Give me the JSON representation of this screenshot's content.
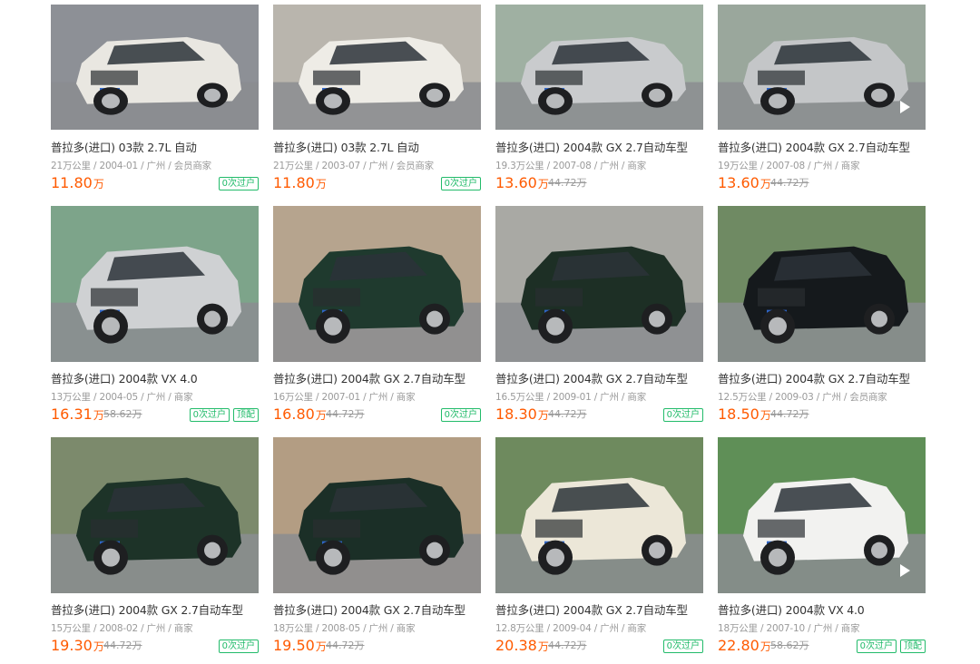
{
  "colors": {
    "price": "#ff5a00",
    "meta": "#9a9a9a",
    "tag": "#22bb6a",
    "title": "#333333"
  },
  "listings": [
    {
      "title": "普拉多(进口) 03款 2.7L 自动",
      "meta": "21万公里 / 2004-01 / 广州 / 会员商家",
      "price": "11.80",
      "unit": "万",
      "original_price": "",
      "tags": [
        "0次过户"
      ],
      "has_video": false,
      "car_color": "#e9e7e1",
      "bg": "#8d9096"
    },
    {
      "title": "普拉多(进口) 03款 2.7L 自动",
      "meta": "21万公里 / 2003-07 / 广州 / 会员商家",
      "price": "11.80",
      "unit": "万",
      "original_price": "",
      "tags": [
        "0次过户"
      ],
      "has_video": false,
      "car_color": "#eeece6",
      "bg": "#b9b5ad"
    },
    {
      "title": "普拉多(进口) 2004款 GX 2.7自动车型",
      "meta": "19.3万公里 / 2007-08 / 广州 / 商家",
      "price": "13.60",
      "unit": "万",
      "original_price": "44.72万",
      "tags": [],
      "has_video": false,
      "car_color": "#c9cbcd",
      "bg": "#9fb0a2"
    },
    {
      "title": "普拉多(进口) 2004款 GX 2.7自动车型",
      "meta": "19万公里 / 2007-08 / 广州 / 商家",
      "price": "13.60",
      "unit": "万",
      "original_price": "44.72万",
      "tags": [],
      "has_video": true,
      "car_color": "#c4c6c8",
      "bg": "#9aa79c"
    },
    {
      "title": "普拉多(进口) 2004款 VX 4.0",
      "meta": "13万公里 / 2004-05 / 广州 / 商家",
      "price": "16.31",
      "unit": "万",
      "original_price": "58.62万",
      "tags": [
        "0次过户",
        "顶配"
      ],
      "has_video": false,
      "car_color": "#cfd1d3",
      "bg": "#7da48a"
    },
    {
      "title": "普拉多(进口) 2004款 GX 2.7自动车型",
      "meta": "16万公里 / 2007-01 / 广州 / 商家",
      "price": "16.80",
      "unit": "万",
      "original_price": "44.72万",
      "tags": [
        "0次过户"
      ],
      "has_video": false,
      "car_color": "#1f3a2e",
      "bg": "#b6a48e"
    },
    {
      "title": "普拉多(进口) 2004款 GX 2.7自动车型",
      "meta": "16.5万公里 / 2009-01 / 广州 / 商家",
      "price": "18.30",
      "unit": "万",
      "original_price": "44.72万",
      "tags": [
        "0次过户"
      ],
      "has_video": false,
      "car_color": "#1d2f25",
      "bg": "#a9a9a4"
    },
    {
      "title": "普拉多(进口) 2004款 GX 2.7自动车型",
      "meta": "12.5万公里 / 2009-03 / 广州 / 会员商家",
      "price": "18.50",
      "unit": "万",
      "original_price": "44.72万",
      "tags": [],
      "has_video": false,
      "car_color": "#15191c",
      "bg": "#6f8a63"
    },
    {
      "title": "普拉多(进口) 2004款 GX 2.7自动车型",
      "meta": "15万公里 / 2008-02 / 广州 / 商家",
      "price": "19.30",
      "unit": "万",
      "original_price": "44.72万",
      "tags": [
        "0次过户"
      ],
      "has_video": false,
      "car_color": "#1d3328",
      "bg": "#7c8a6c"
    },
    {
      "title": "普拉多(进口) 2004款 GX 2.7自动车型",
      "meta": "18万公里 / 2008-05 / 广州 / 商家",
      "price": "19.50",
      "unit": "万",
      "original_price": "44.72万",
      "tags": [],
      "has_video": false,
      "car_color": "#1b2f27",
      "bg": "#b39d83"
    },
    {
      "title": "普拉多(进口) 2004款 GX 2.7自动车型",
      "meta": "12.8万公里 / 2009-04 / 广州 / 商家",
      "price": "20.38",
      "unit": "万",
      "original_price": "44.72万",
      "tags": [
        "0次过户"
      ],
      "has_video": false,
      "car_color": "#ece7d8",
      "bg": "#6e8a5e"
    },
    {
      "title": "普拉多(进口) 2004款 VX 4.0",
      "meta": "18万公里 / 2007-10 / 广州 / 商家",
      "price": "22.80",
      "unit": "万",
      "original_price": "58.62万",
      "tags": [
        "0次过户",
        "顶配"
      ],
      "has_video": true,
      "car_color": "#f2f2f0",
      "bg": "#5f8f57"
    }
  ]
}
